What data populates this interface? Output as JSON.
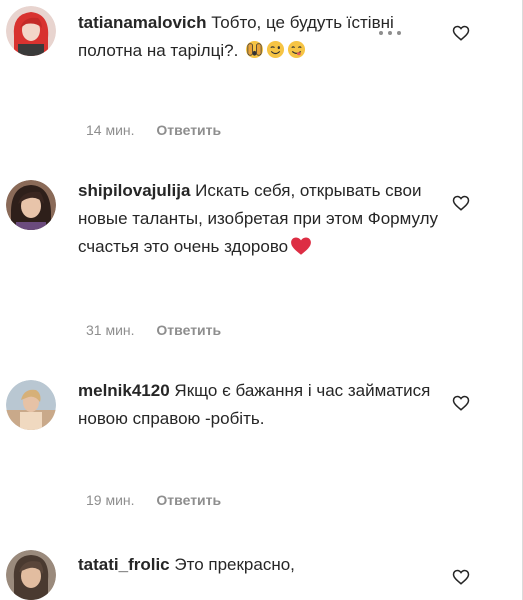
{
  "comments": [
    {
      "username": "tatianamalovich",
      "text": "Тобто, це будуть їстівні полотна на тарілці?.",
      "emojis": [
        "hands-over-face-emoji",
        "winking-face-emoji",
        "yum-face-emoji"
      ],
      "time": "14 мин.",
      "reply_label": "Ответить"
    },
    {
      "username": "shipilovajulija",
      "text": "Искать себя, открывать свои новые таланты, изобретая при этом Формулу счастья это очень здорово",
      "emojis": [
        "red-heart-emoji"
      ],
      "time": "31 мин.",
      "reply_label": "Ответить"
    },
    {
      "username": "melnik4120",
      "text": "Якщо є бажання і час займатися новою справою -робіть.",
      "emojis": [],
      "time": "19 мин.",
      "reply_label": "Ответить"
    },
    {
      "username": "tatati_frolic",
      "text": "Это прекрасно,",
      "emojis": [],
      "time": "",
      "reply_label": ""
    }
  ],
  "icons": {
    "more": "more-options-icon",
    "like": "heart-outline-icon"
  },
  "colors": {
    "text": "#262626",
    "secondary": "#8e8e8e",
    "heart_red": "#e0245e"
  }
}
